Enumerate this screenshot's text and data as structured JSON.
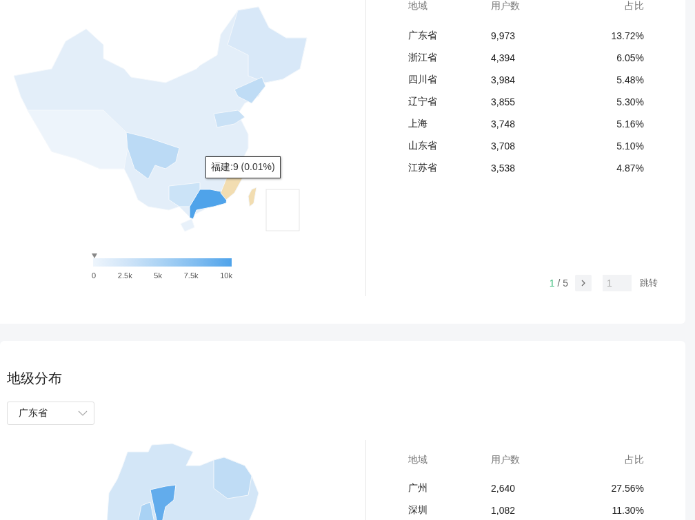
{
  "province_section": {
    "map": {
      "tooltip": "福建:9 (0.01%)",
      "legend_ticks": [
        "0",
        "2.5k",
        "5k",
        "7.5k",
        "10k"
      ]
    },
    "table": {
      "columns": [
        "地域",
        "用户数",
        "占比"
      ],
      "rows": [
        [
          "广东省",
          "9,973",
          "13.72%"
        ],
        [
          "浙江省",
          "4,394",
          "6.05%"
        ],
        [
          "四川省",
          "3,984",
          "5.48%"
        ],
        [
          "辽宁省",
          "3,855",
          "5.30%"
        ],
        [
          "上海",
          "3,748",
          "5.16%"
        ],
        [
          "山东省",
          "3,708",
          "5.10%"
        ],
        [
          "江苏省",
          "3,538",
          "4.87%"
        ]
      ]
    },
    "pagination": {
      "current": "1",
      "total": "/ 5",
      "jump_value": "1",
      "jump_button": "跳转"
    }
  },
  "city_section": {
    "title": "地级分布",
    "select": {
      "value": "广东省"
    },
    "table": {
      "columns": [
        "地域",
        "用户数",
        "占比"
      ],
      "rows": [
        [
          "广州",
          "2,640",
          "27.56%"
        ],
        [
          "深圳",
          "1,082",
          "11.30%"
        ]
      ]
    }
  }
}
